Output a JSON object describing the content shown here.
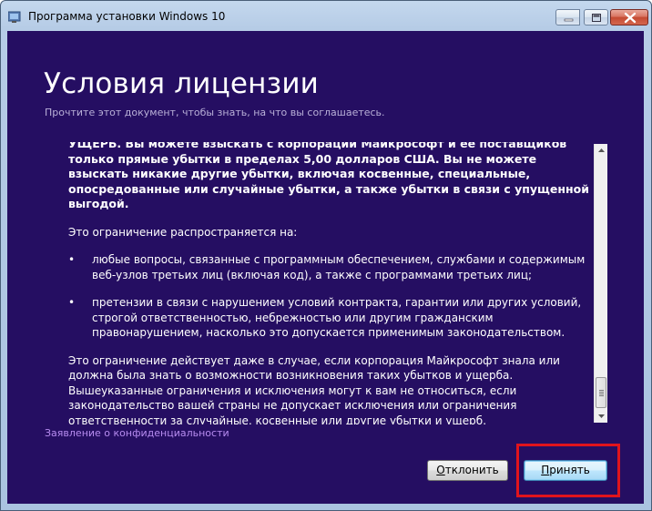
{
  "window": {
    "title": "Программа установки Windows 10"
  },
  "page": {
    "heading": "Условия лицензии",
    "subheading": "Прочтите этот документ, чтобы знать, на что вы соглашаетесь."
  },
  "license": {
    "bold_paragraph": "УЩЕРБ. Вы можете взыскать с корпорации Майкрософт и ее поставщиков только прямые убытки в пределах 5,00 долларов США. Вы не можете взыскать никакие другие убытки, включая косвенные, специальные, опосредованные или случайные убытки, а также убытки в связи с упущенной выгодой.",
    "scope_intro": "Это ограничение распространяется на:",
    "bullet_1": "любые вопросы, связанные с программным обеспечением, службами и содержимым веб-узлов третьих лиц (включая код), а также с программами третьих лиц;",
    "bullet_2": "претензии в связи с нарушением условий контракта, гарантии или других условий, строгой ответственностью, небрежностью или другим гражданским правонарушением, насколько это допускается применимым законодательством.",
    "closing_paragraph": "Это ограничение действует даже в случае, если корпорация Майкрософт знала или должна была знать о возможности возникновения таких убытков и ущерба. Вышеуказанные ограничения и исключения могут к вам не относиться, если законодательство вашей страны не допускает исключения или ограничения ответственности за случайные, косвенные или другие убытки и ущерб.",
    "bullet_symbol": "•"
  },
  "links": {
    "privacy": "Заявление о конфиденциальности"
  },
  "buttons": {
    "decline_mnemonic": "О",
    "decline_rest": "тклонить",
    "accept_mnemonic": "П",
    "accept_rest": "ринять"
  },
  "colors": {
    "background": "#250e62",
    "link": "#b78cf0",
    "highlight": "#e0141c"
  },
  "icons": {
    "window_icon": "windows-setup-icon",
    "minimize": "minimize-icon",
    "maximize": "maximize-icon",
    "close": "close-icon"
  }
}
